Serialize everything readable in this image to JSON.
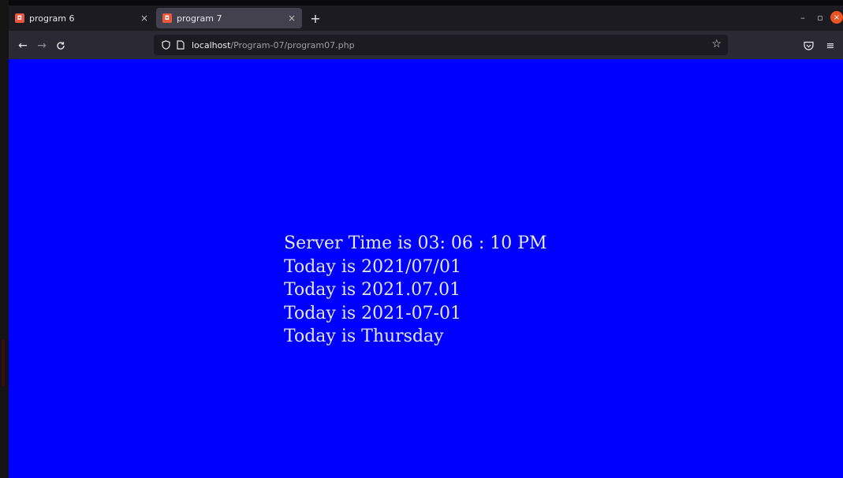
{
  "tabs": [
    {
      "title": "program 6",
      "close": "×",
      "active": false
    },
    {
      "title": "program 7",
      "close": "×",
      "active": true
    }
  ],
  "new_tab": "+",
  "window_controls": {
    "minimize": "–",
    "maximize": "▫",
    "close": "×"
  },
  "address_bar": {
    "host": "localhost",
    "path": "/Program-07/program07.php"
  },
  "page": {
    "background_color": "#0000ff",
    "lines": [
      "Server Time is 03: 06 : 10 PM",
      "Today is 2021/07/01",
      "Today is 2021.07.01",
      "Today is 2021-07-01",
      "Today is Thursday"
    ]
  }
}
